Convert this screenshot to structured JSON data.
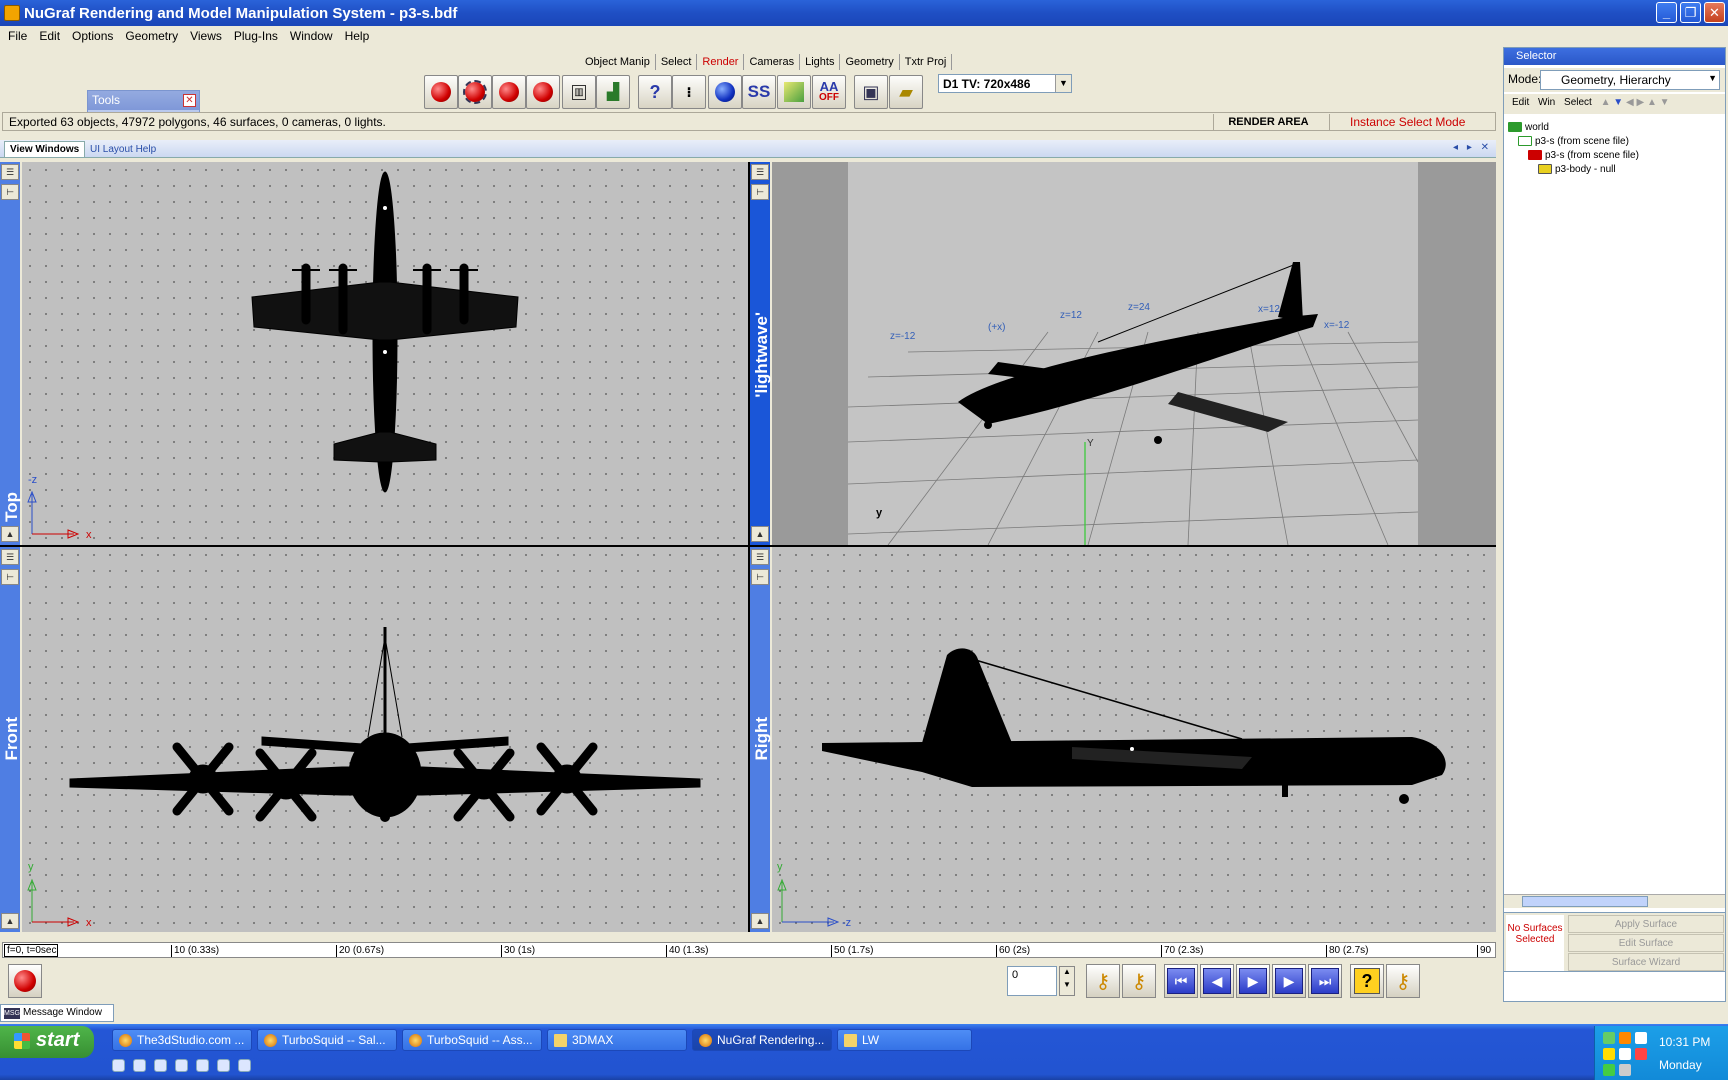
{
  "window": {
    "title": "NuGraf Rendering and Model Manipulation System - p3-s.bdf",
    "minimize": "_",
    "maximize": "❐",
    "close": "✕"
  },
  "menu": [
    "File",
    "Edit",
    "Options",
    "Geometry",
    "Views",
    "Plug-Ins",
    "Window",
    "Help"
  ],
  "toolbar_tabs": [
    "Object Manip",
    "Select",
    "Render",
    "Cameras",
    "Lights",
    "Geometry",
    "Txtr Proj"
  ],
  "toolbar_buttons": {
    "aa_label": "AA",
    "aa_off": "OFF",
    "ss_label": "SS",
    "help_label": "?"
  },
  "resolution": "D1 TV: 720x486",
  "tools_window": {
    "title": "Tools"
  },
  "status": {
    "message": "Exported 63 objects, 47972 polygons, 46 surfaces, 0 cameras, 0 lights.",
    "area": "RENDER AREA",
    "mode": "Instance Select Mode"
  },
  "view_windows": {
    "tab": "View Windows",
    "help_tab": "UI Layout Help",
    "controls": "◂ ▸ ✕"
  },
  "viewports": {
    "top": {
      "label": "Top",
      "axis_v": "-z",
      "axis_h": "x"
    },
    "persp": {
      "label": "'lightwave'",
      "labels": [
        "z=-12",
        "(+x)",
        "z=12",
        "z=24",
        "x=12",
        "x=-12"
      ],
      "axis_y": "Y",
      "gizmo": "y"
    },
    "front": {
      "label": "Front",
      "axis_v": "y",
      "axis_h": "x"
    },
    "right": {
      "label": "Right",
      "axis_v": "y",
      "axis_h": "-z"
    }
  },
  "selector": {
    "title": "Selector",
    "mode_label": "Mode:",
    "mode_value": "Geometry, Hierarchy",
    "edit": "Edit",
    "win": "Win",
    "select": "Select",
    "tree": [
      {
        "label": "world",
        "indent": 0
      },
      {
        "label": "p3-s (from scene file)",
        "indent": 1
      },
      {
        "label": "p3-s (from scene file)",
        "indent": 2
      },
      {
        "label": "p3-body - null",
        "indent": 3
      }
    ]
  },
  "surfaces": {
    "none": "No Surfaces Selected",
    "apply": "Apply Surface",
    "edit": "Edit Surface",
    "wizard": "Surface Wizard"
  },
  "timeline": {
    "frame_label": "f=0, t=0sec",
    "ticks": [
      "10 (0.33s)",
      "20 (0.67s)",
      "30 (1s)",
      "40 (1.3s)",
      "50 (1.7s)",
      "60 (2s)",
      "70 (2.3s)",
      "80 (2.7s)",
      "90"
    ]
  },
  "frame_value": "0",
  "message_window": "Message Window",
  "taskbar": {
    "start": "start",
    "tasks": [
      "The3dStudio.com ...",
      "TurboSquid -- Sal...",
      "TurboSquid -- Ass...",
      "3DMAX",
      "NuGraf Rendering...",
      "LW"
    ],
    "time": "10:31 PM",
    "day": "Monday"
  },
  "colors": {
    "titlebar": "#2a63d9",
    "viewport_bg": "#c0c0c0",
    "side_label": "#4f7ee3",
    "status_mode": "#cc0000",
    "taskbar": "#2456d6"
  }
}
